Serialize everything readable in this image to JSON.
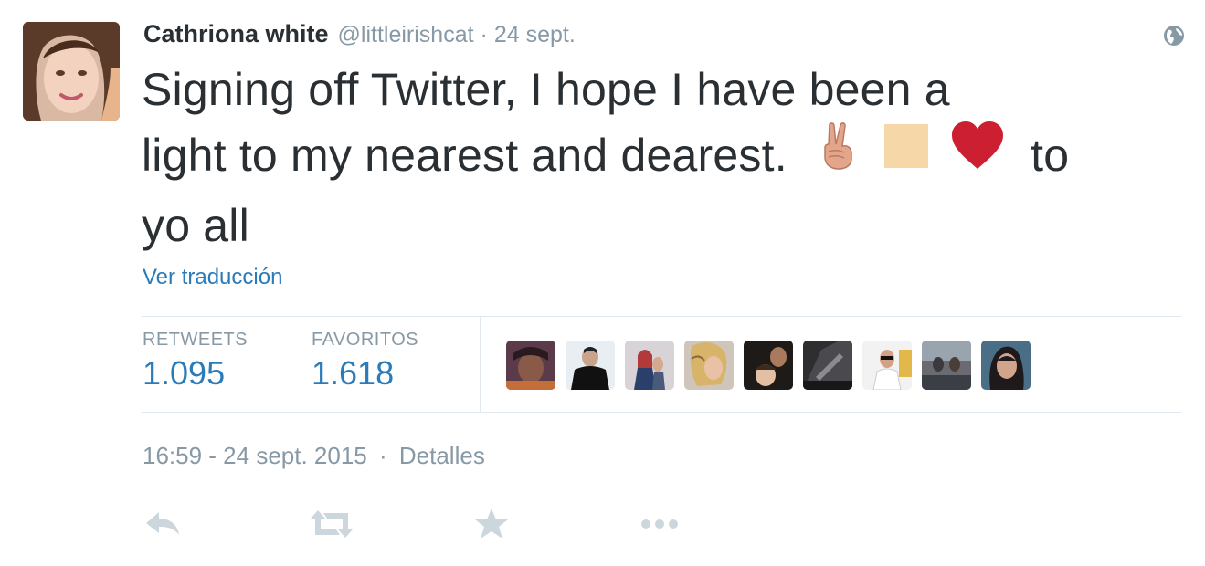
{
  "tweet": {
    "fullname": "Cathriona white",
    "username": "@littleirishcat",
    "separator": "·",
    "short_time": "24 sept.",
    "text_line1": "Signing off Twitter, I hope I have been a",
    "text_line2": "light to my nearest and dearest.",
    "text_line2_tail": "to",
    "text_line3": "yo all",
    "emojis": [
      "peace-hand-emoji",
      "square-emoji",
      "heart-emoji"
    ],
    "translate_label": "Ver traducción"
  },
  "stats": {
    "retweets_label": "RETWEETS",
    "retweets_count": "1.095",
    "favorites_label": "FAVORITOS",
    "favorites_count": "1.618",
    "favoriters_count": 9
  },
  "meta": {
    "timestamp": "16:59 - 24 sept. 2015",
    "separator": "·",
    "details_label": "Detalles"
  },
  "actions": [
    "reply-icon",
    "retweet-icon",
    "favorite-icon",
    "more-icon"
  ],
  "colors": {
    "text": "#292f33",
    "muted": "#8899a6",
    "link": "#2b7bb9",
    "border": "#e1e8ed",
    "heart": "#cc2032",
    "action_icon": "#ccd6dd"
  }
}
